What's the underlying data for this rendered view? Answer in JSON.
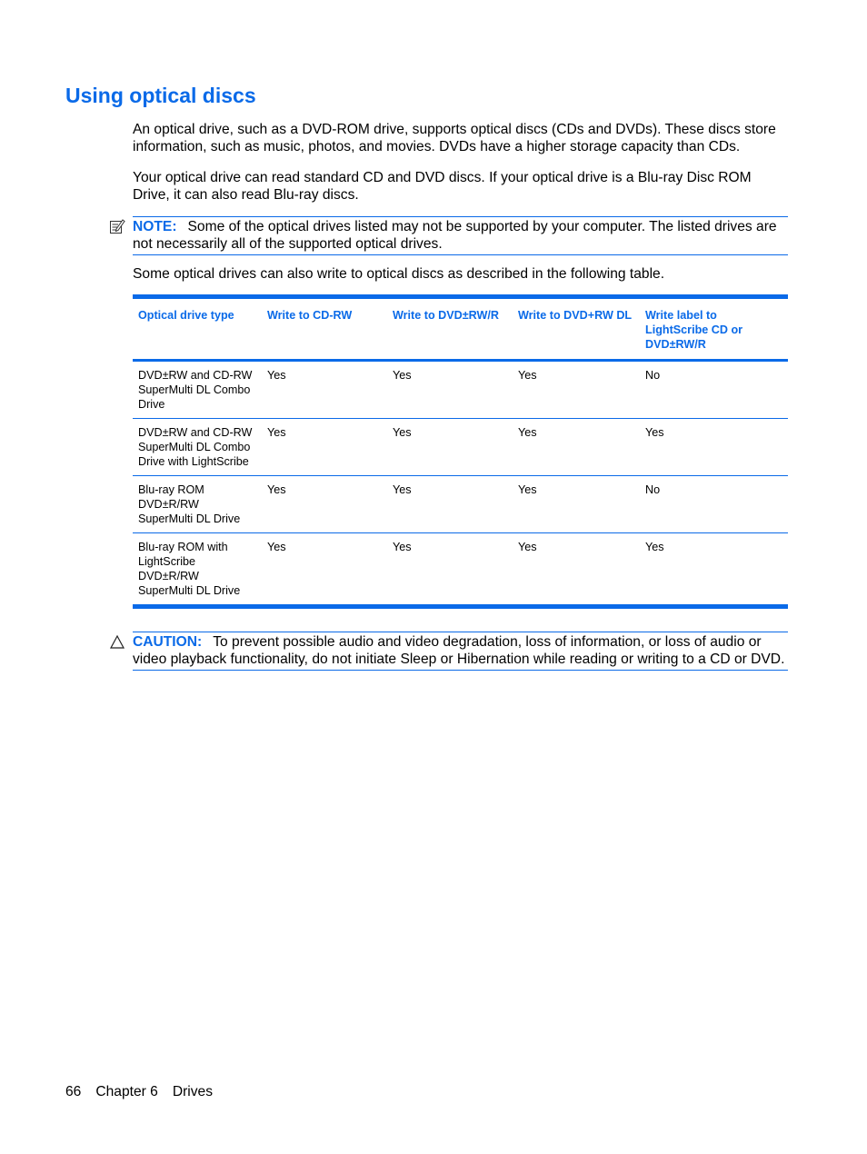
{
  "page": {
    "title": "Using optical discs",
    "paragraphs": [
      "An optical drive, such as a DVD-ROM drive, supports optical discs (CDs and DVDs). These discs store information, such as music, photos, and movies. DVDs have a higher storage capacity than CDs.",
      "Your optical drive can read standard CD and DVD discs. If your optical drive is a Blu-ray Disc ROM Drive, it can also read Blu-ray discs.",
      "Some optical drives can also write to optical discs as described in the following table."
    ],
    "note": {
      "icon": "note-pencil-icon",
      "label": "NOTE:",
      "text": "Some of the optical drives listed may not be supported by your computer. The listed drives are not necessarily all of the supported optical drives."
    },
    "caution": {
      "icon": "warning-triangle-icon",
      "label": "CAUTION:",
      "text": "To prevent possible audio and video degradation, loss of information, or loss of audio or video playback functionality, do not initiate Sleep or Hibernation while reading or writing to a CD or DVD."
    }
  },
  "table": {
    "headers": [
      "Optical drive type",
      "Write to CD-RW",
      "Write to DVD±RW/R",
      "Write to DVD+RW DL",
      "Write label to LightScribe CD or DVD±RW/R"
    ],
    "rows": [
      [
        "DVD±RW and CD-RW SuperMulti DL Combo Drive",
        "Yes",
        "Yes",
        "Yes",
        "No"
      ],
      [
        "DVD±RW and CD-RW SuperMulti DL Combo Drive with LightScribe",
        "Yes",
        "Yes",
        "Yes",
        "Yes"
      ],
      [
        "Blu-ray ROM DVD±R/RW SuperMulti DL Drive",
        "Yes",
        "Yes",
        "Yes",
        "No"
      ],
      [
        "Blu-ray ROM with LightScribe DVD±R/RW SuperMulti DL Drive",
        "Yes",
        "Yes",
        "Yes",
        "Yes"
      ]
    ]
  },
  "footer": {
    "page_number": "66",
    "chapter": "Chapter 6",
    "section": "Drives"
  },
  "colors": {
    "accent": "#0a6ae8"
  }
}
